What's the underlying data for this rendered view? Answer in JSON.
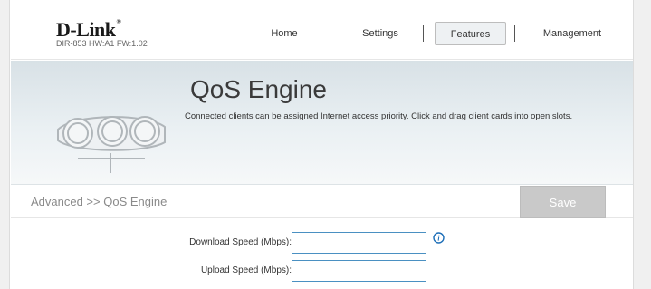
{
  "header": {
    "logo": "D-Link",
    "logo_reg": "®",
    "model": "DIR-853 HW:A1 FW:1.02"
  },
  "nav": {
    "items": [
      {
        "label": "Home"
      },
      {
        "label": "Settings"
      },
      {
        "label": "Features"
      },
      {
        "label": "Management"
      }
    ],
    "active": "Features"
  },
  "banner": {
    "title": "QoS Engine",
    "description": "Connected clients can be assigned Internet access priority. Click and drag client cards into open slots."
  },
  "subbar": {
    "breadcrumb": "Advanced >> QoS Engine",
    "save_label": "Save"
  },
  "form": {
    "download_label": "Download Speed (Mbps):",
    "download_value": "",
    "upload_label": "Upload Speed (Mbps):",
    "upload_value": ""
  },
  "colors": {
    "input_border": "#4a90c2",
    "save_bg": "#c9c9c9",
    "info_icon": "#1e6fb8"
  }
}
